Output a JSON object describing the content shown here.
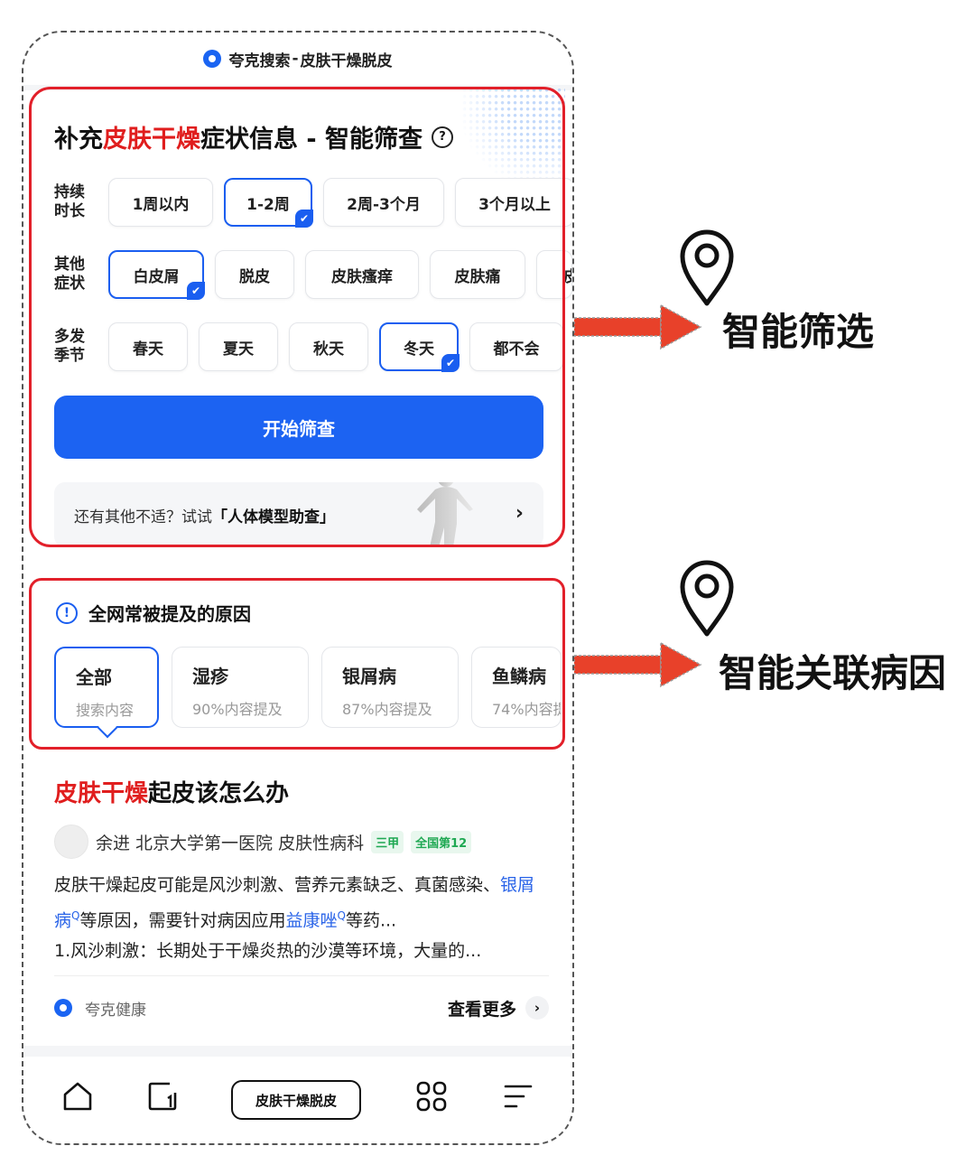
{
  "header": {
    "app_name": "夸克搜索",
    "query": "皮肤干燥脱皮"
  },
  "screening": {
    "title_prefix": "补充",
    "title_highlight": "皮肤干燥",
    "title_suffix": "症状信息 - 智能筛查",
    "help_icon": "?",
    "rows": [
      {
        "label_line1": "持续",
        "label_line2": "时长",
        "options": [
          "1周以内",
          "1-2周",
          "2周-3个月",
          "3个月以上"
        ],
        "selected": "1-2周"
      },
      {
        "label_line1": "其他",
        "label_line2": "症状",
        "options": [
          "白皮屑",
          "脱皮",
          "皮肤瘙痒",
          "皮肤痛",
          "皮"
        ],
        "selected": "白皮屑"
      },
      {
        "label_line1": "多发",
        "label_line2": "季节",
        "options": [
          "春天",
          "夏天",
          "秋天",
          "冬天",
          "都不会"
        ],
        "selected": "冬天"
      }
    ],
    "start_button": "开始筛查",
    "model_prompt": "还有其他不适？试试",
    "model_link": "「人体模型助查」",
    "chevron": "›"
  },
  "causes": {
    "title": "全网常被提及的原因",
    "info_icon": "!",
    "items": [
      {
        "name": "全部",
        "detail": "搜索内容",
        "selected": true
      },
      {
        "name": "湿疹",
        "detail": "90%内容提及",
        "selected": false
      },
      {
        "name": "银屑病",
        "detail": "87%内容提及",
        "selected": false
      },
      {
        "name": "鱼鳞病",
        "detail": "74%内容提",
        "selected": false
      }
    ]
  },
  "article": {
    "title_highlight": "皮肤干燥",
    "title_rest": "起皮该怎么办",
    "author": "余进 北京大学第一医院 皮肤性病科",
    "tag1": "三甲",
    "tag2": "全国第12",
    "body_part1": "皮肤干燥起皮可能是风沙刺激、营养元素缺乏、真菌感染、",
    "link1": "银屑病",
    "body_part2": "等原因，需要针对病因应用",
    "link2": "益康唑",
    "body_part3": "等药...",
    "body_line3": "1.风沙刺激：长期处于干燥炎热的沙漠等环境，大量的...",
    "search_mark": "Q",
    "source": "夸克健康",
    "more": "查看更多",
    "more_chevron": "›"
  },
  "bottom_nav": {
    "query_pill": "皮肤干燥脱皮",
    "icons": [
      "home-icon",
      "tabs-icon",
      "apps-icon",
      "menu-icon"
    ]
  },
  "annotations": {
    "label1": "智能筛选",
    "label2": "智能关联病因"
  },
  "colors": {
    "accent": "#1c63f2",
    "highlight_red": "#e01e1e",
    "annotation_red": "#e2202a",
    "tag_green": "#1ea852"
  }
}
